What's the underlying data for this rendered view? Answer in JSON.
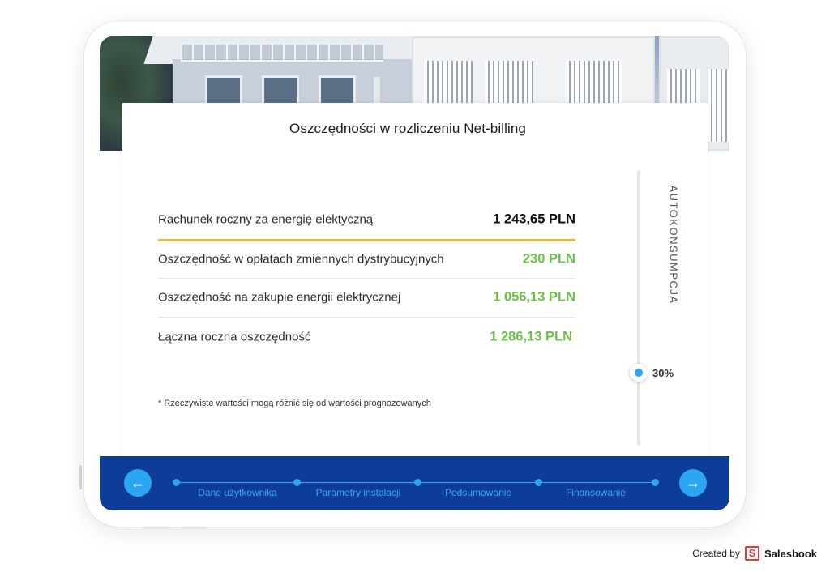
{
  "card": {
    "title": "Oszczędności w rozliczeniu Net-billing"
  },
  "rows": [
    {
      "label": "Rachunek roczny za energię elektyczną",
      "value": "1 243,65 PLN"
    },
    {
      "label": "Oszczędność w opłatach zmiennych dystrybucyjnych",
      "value": "230 PLN"
    },
    {
      "label": "Oszczędność na zakupie energii elektrycznej",
      "value": "1 056,13 PLN"
    },
    {
      "label": "Łączna roczna oszczędność",
      "value": "1 286,13 PLN"
    }
  ],
  "footnote": "* Rzeczywiste wartości mogą różnić się od wartości prognozowanych",
  "slider": {
    "label": "AUTOKONSUMPCJA",
    "value_text": "30%",
    "value": 0.3
  },
  "nav": {
    "prev_icon": "arrow-left-icon",
    "next_icon": "arrow-right-icon",
    "steps": [
      "Dane użytkownika",
      "Parametry instalacji",
      "Podsumowanie",
      "Finansowanie"
    ]
  },
  "credit": {
    "prefix": "Created by",
    "brand": "Salesbook",
    "brand_icon": "salesbook-logo-icon"
  },
  "colors": {
    "nav_bg": "#0d3d98",
    "accent_blue": "#2aa6f2",
    "green": "#6cc24a",
    "accent_line": "#f2b63c"
  }
}
